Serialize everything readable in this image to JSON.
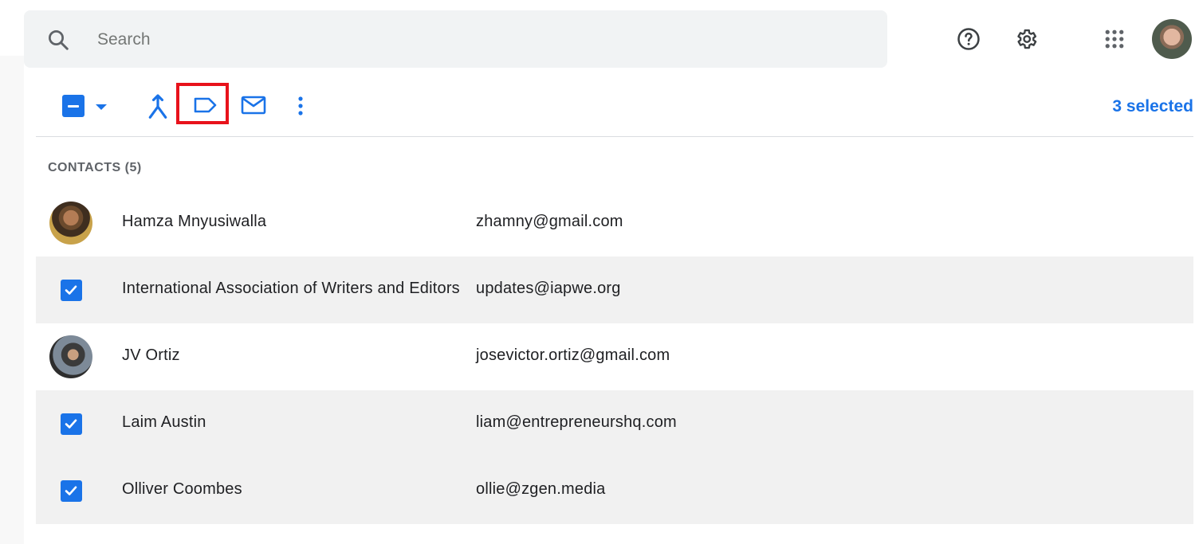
{
  "search": {
    "placeholder": "Search",
    "icon": "search-icon"
  },
  "header": {
    "icons": [
      "help-icon",
      "gear-icon",
      "apps-grid-icon",
      "account-avatar"
    ]
  },
  "toolbar": {
    "selected_count": "3 selected",
    "icons": [
      "select-partial-checkbox",
      "chevron-down-icon",
      "merge-icon",
      "label-icon",
      "email-icon",
      "more-vert-icon"
    ],
    "highlight_color": "#e8121b"
  },
  "contacts": {
    "heading": "CONTACTS (5)",
    "rows": [
      {
        "name": "Hamza Mnyusiwalla",
        "email": "zhamny@gmail.com",
        "selected": false
      },
      {
        "name": "International Association of Writers and Editors",
        "email": "updates@iapwe.org",
        "selected": true
      },
      {
        "name": "JV Ortiz",
        "email": "josevictor.ortiz@gmail.com",
        "selected": false
      },
      {
        "name": "Laim Austin",
        "email": "liam@entrepreneurshq.com",
        "selected": true
      },
      {
        "name": "Olliver Coombes",
        "email": "ollie@zgen.media",
        "selected": true
      }
    ]
  },
  "colors": {
    "accent": "#1a73e8",
    "selected_row": "#f1f1f1",
    "search_bg": "#f1f3f4"
  }
}
